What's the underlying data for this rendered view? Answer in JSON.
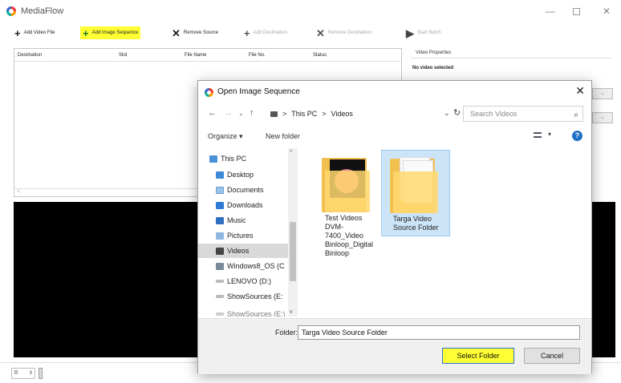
{
  "app": {
    "title": "MediaFlow",
    "minimize": "—",
    "close": "✕"
  },
  "toolbar": {
    "add_video_file": "Add Video File",
    "add_image_sequence": "Add Image Sequence",
    "remove_source": "Remove Source",
    "add_destination": "Add Destination",
    "remove_destination": "Remove Destination",
    "start_batch": "Start Batch",
    "highlight_color": "#ffff33"
  },
  "list": {
    "columns": [
      "Destination",
      "Slot",
      "File Name",
      "File No.",
      "Status"
    ],
    "scroll_left": "<"
  },
  "properties": {
    "label": "Video Properties",
    "value": "No video selected"
  },
  "bottom": {
    "frame_value": "0"
  },
  "dialog": {
    "title": "Open Image Sequence",
    "close": "✕",
    "path": [
      "This PC",
      "Videos"
    ],
    "search_placeholder": "Search Videos",
    "organize": "Organize ▾",
    "new_folder": "New folder",
    "help": "?",
    "nav_items": [
      "This PC",
      "Desktop",
      "Documents",
      "Downloads",
      "Music",
      "Pictures",
      "Videos",
      "Windows8_OS (C",
      "LENOVO (D:)",
      "ShowSources (E:",
      "ShowSources (E:)"
    ],
    "selected_nav": "Videos",
    "folders": [
      {
        "name": "Test Videos DVM-7400_Video Binloop_Digital Binloop",
        "selected": false
      },
      {
        "name": "Targa Video Source Folder",
        "selected": true
      }
    ],
    "folder_label": "Folder:",
    "folder_value": "Targa Video Source Folder",
    "select_button": "Select Folder",
    "cancel_button": "Cancel",
    "accent_color": "#1f6fc5",
    "selection_color": "#cce4f7"
  }
}
